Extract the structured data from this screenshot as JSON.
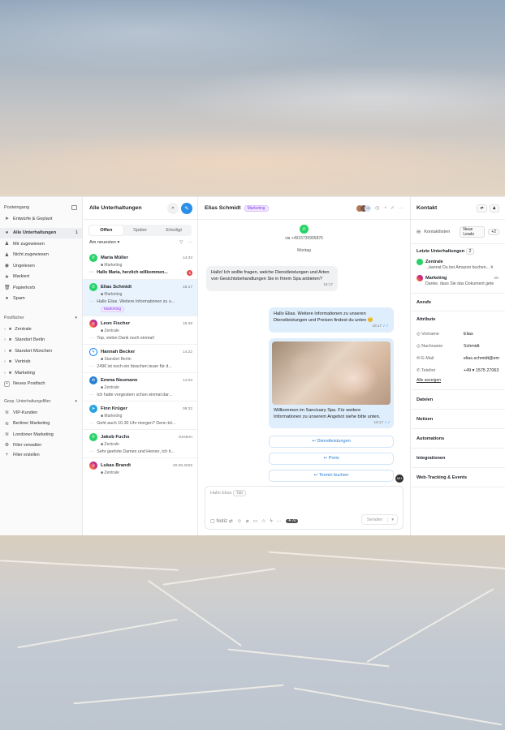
{
  "sidebar": {
    "header": "Posteingang",
    "items": [
      {
        "label": "Entwürfe & Geplant",
        "icon": "send-icon",
        "count": ""
      },
      {
        "label": "Alle Unterhaltungen",
        "icon": "chat-icon",
        "count": "1"
      },
      {
        "label": "Mir zugewiesen",
        "icon": "user-icon",
        "count": ""
      },
      {
        "label": "Nicht zugewiesen",
        "icon": "user-x-icon",
        "count": ""
      },
      {
        "label": "Ungelesen",
        "icon": "eye-icon",
        "count": ""
      },
      {
        "label": "Markiert",
        "icon": "star-icon",
        "count": ""
      },
      {
        "label": "Papierkorb",
        "icon": "trash-icon",
        "count": ""
      },
      {
        "label": "Spam",
        "icon": "alert-icon",
        "count": ""
      }
    ],
    "folders_header": "Postfächer",
    "folders": [
      "Zentrale",
      "Standort Berlin",
      "Standort München",
      "Vertrieb",
      "Marketing"
    ],
    "new_inbox": "Neues Postfach",
    "filters_header": "Gesp. Unterhaltungsfilter",
    "filters": [
      "VIP-Kunden",
      "Berliner Marketing",
      "Londoner Marketing"
    ],
    "manage_filters": "Filter verwalten",
    "create_filter": "Filter erstellen"
  },
  "list": {
    "title": "Alle Unterhaltungen",
    "tabs": [
      "Offen",
      "Später",
      "Erledigt"
    ],
    "sort": "Am neuesten",
    "items": [
      {
        "name": "Maria Müller",
        "time": "14:33",
        "folder": "Marketing",
        "preview": "Hallo Maria, herzlich willkommen...",
        "badge": "1",
        "channel": "whatsapp",
        "bold": true
      },
      {
        "name": "Elias Schmidt",
        "time": "16:17",
        "folder": "Marketing",
        "preview": "Hallo Elias. Weitere Informationen zu u...",
        "tag": "Marketing",
        "channel": "whatsapp"
      },
      {
        "name": "Leon Fischer",
        "time": "15:49",
        "folder": "Zentrale",
        "preview": "Top, vielen Dank noch einmal!",
        "channel": "instagram"
      },
      {
        "name": "Hannah Becker",
        "time": "14:22",
        "folder": "Standort Berlin",
        "preview": "249€ ist noch ein bisschen teuer für d...",
        "channel": "messenger"
      },
      {
        "name": "Emma Neumann",
        "time": "14:03",
        "folder": "Zentrale",
        "preview": "Ich hatte vorgestern schon einmal dar...",
        "channel": "email"
      },
      {
        "name": "Finn Krüger",
        "time": "09:32",
        "folder": "Marketing",
        "preview": "Geht auch 10.30 Uhr morgen? Denn kö...",
        "channel": "telegram"
      },
      {
        "name": "Jakob Fuchs",
        "time": "Gestern",
        "folder": "Zentrale",
        "preview": "Sehr geehrte Damen und Herren, ich h...",
        "channel": "whatsapp"
      },
      {
        "name": "Lukas Brandt",
        "time": "20.06.2026",
        "folder": "Zentrale",
        "preview": "",
        "channel": "instagram"
      }
    ]
  },
  "chat": {
    "contact": "Elias Schmidt",
    "tag": "Marketing",
    "via": "via +4915735995876",
    "day": "Montag",
    "msg_in": "Hallo! Ich wollte fragen, welche Dienstleistungen und Arten von Gesichtsbehandlungen Sie in Ihrem Spa anbieten?",
    "msg_in_time": "16:17",
    "msg_out1": "Hallo Elias. Weitere Informationen zu unseren Dienstleistungen und Preisen findest du unten 😊",
    "msg_out1_time": "16:17",
    "msg_out2": "Willkommen im Sanctuary Spa. Für weitere Informationen zu unserem Angebot siehe bitte unten.",
    "msg_out2_time": "16:17",
    "buttons": [
      "Dienstleistungen",
      "Preis",
      "Termin buchen"
    ],
    "avatar_initials": "MH",
    "compose_placeholder": "Hallo Elias",
    "compose_hint": "Tab",
    "note_label": "Notiz",
    "ai_label": "AI",
    "send_label": "Senden"
  },
  "contact_panel": {
    "title": "Kontakt",
    "lists_label": "Kontaktlisten",
    "list_chip": "Neue Leads",
    "list_more": "+2",
    "recent_title": "Letzte Unterhaltungen",
    "recent_count": "2",
    "recent": [
      {
        "name": "Zentrale",
        "time": "",
        "preview": "...kannst Du bei Amazon buchen... h",
        "channel": "whatsapp"
      },
      {
        "name": "Marketing",
        "time": "20.",
        "preview": "Danke, dass Sie das Dokument gete",
        "channel": "instagram"
      }
    ],
    "calls": "Anrufe",
    "attributes": "Attribute",
    "attrs": [
      {
        "k": "Vorname",
        "v": "Elias"
      },
      {
        "k": "Nachname",
        "v": "Schmidt"
      },
      {
        "k": "E-Mail",
        "v": "elias.schmidt@em"
      },
      {
        "k": "Telefon",
        "v": "+49 ▾  1575 27063"
      }
    ],
    "show_all": "Alle anzeigen",
    "sections": [
      "Dateien",
      "Notizen",
      "Automations",
      "Integrationen",
      "Web-Tracking & Events"
    ]
  },
  "colors": {
    "accent": "#2b8fe8",
    "whatsapp": "#25d366",
    "instagram": "#e1306c",
    "messenger": "#0a7cff",
    "telegram": "#2aa3e0",
    "tag_purple": "#7c3aed"
  }
}
